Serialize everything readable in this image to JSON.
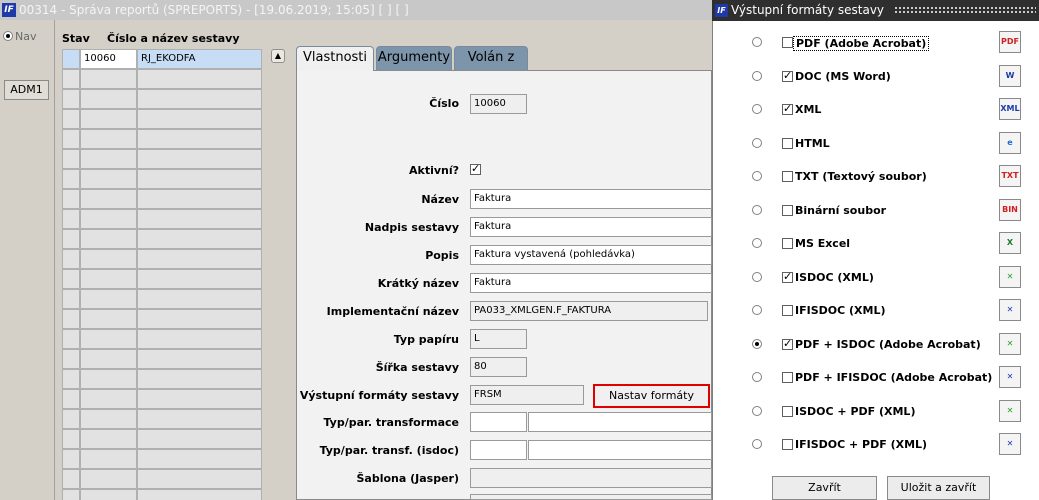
{
  "main_window": {
    "title": "00314 - Správa reportů (SPREPORTS) - [19.06.2019; 15:05]  [ ]  [ ]",
    "nav_label": "Nav",
    "adm_label": "ADM1",
    "grid": {
      "col_stav": "Stav",
      "col_cislo": "Číslo a název sestavy",
      "selected_row": {
        "cislo": "10060",
        "nazev": "RJ_EKODFA"
      },
      "empty_rows": 22
    },
    "tabs": [
      {
        "label": "Vlastnosti",
        "active": true
      },
      {
        "label": "Argumenty",
        "active": false
      },
      {
        "label": "Volán z",
        "active": false
      }
    ],
    "form": {
      "cislo": {
        "label": "Číslo",
        "value": "10060"
      },
      "aktivni": {
        "label": "Aktivní?",
        "checked": true
      },
      "nazev": {
        "label": "Název",
        "value": "Faktura"
      },
      "nadpis": {
        "label": "Nadpis sestavy",
        "value": "Faktura"
      },
      "popis": {
        "label": "Popis",
        "value": "Faktura vystavená (pohledávka)"
      },
      "kratky": {
        "label": "Krátký název",
        "value": "Faktura"
      },
      "implementacni": {
        "label": "Implementační název",
        "value": "PA033_XMLGEN.F_FAKTURA"
      },
      "typ_papiru": {
        "label": "Typ papíru",
        "value": "L"
      },
      "sirka": {
        "label": "Šířka sestavy",
        "value": "80"
      },
      "vystupni": {
        "label": "Výstupní formáty sestavy",
        "value": "FRSM",
        "button": "Nastav formáty"
      },
      "transformace": {
        "label": "Typ/par. transformace",
        "value": ""
      },
      "transf_isdoc": {
        "label": "Typ/par. transf. (isdoc)",
        "value": ""
      },
      "sablona": {
        "label": "Šablona (Jasper)",
        "value": ""
      }
    }
  },
  "dialog": {
    "title": "Výstupní formáty sestavy",
    "formats": [
      {
        "label": "PDF (Adobe Acrobat)",
        "checked": false,
        "default": false,
        "icon": "pdf-icon",
        "icon_text": "PDF",
        "icon_color": "#d02020"
      },
      {
        "label": "DOC (MS Word)",
        "checked": true,
        "default": false,
        "icon": "word-icon",
        "icon_text": "W",
        "icon_color": "#1f3aa8"
      },
      {
        "label": "XML",
        "checked": true,
        "default": false,
        "icon": "xml-icon",
        "icon_text": "XML",
        "icon_color": "#1f3aa8"
      },
      {
        "label": "HTML",
        "checked": false,
        "default": false,
        "icon": "html-icon",
        "icon_text": "e",
        "icon_color": "#1e6fd0"
      },
      {
        "label": "TXT (Textový soubor)",
        "checked": false,
        "default": false,
        "icon": "txt-icon",
        "icon_text": "TXT",
        "icon_color": "#d02020"
      },
      {
        "label": "Binární soubor",
        "checked": false,
        "default": false,
        "icon": "binary-icon",
        "icon_text": "BIN",
        "icon_color": "#d02020"
      },
      {
        "label": "MS Excel",
        "checked": false,
        "default": false,
        "icon": "excel-icon",
        "icon_text": "X",
        "icon_color": "#1e7a2e"
      },
      {
        "label": "ISDOC (XML)",
        "checked": true,
        "default": false,
        "icon": "isdoc-icon",
        "icon_text": "✕",
        "icon_color": "#2a9a2a"
      },
      {
        "label": "IFISDOC (XML)",
        "checked": false,
        "default": false,
        "icon": "ifisdoc-icon",
        "icon_text": "✕",
        "icon_color": "#1f3aa8"
      },
      {
        "label": "PDF + ISDOC (Adobe Acrobat)",
        "checked": true,
        "default": true,
        "icon": "pdf-isdoc-icon",
        "icon_text": "✕",
        "icon_color": "#2a9a2a"
      },
      {
        "label": "PDF + IFISDOC (Adobe Acrobat)",
        "checked": false,
        "default": false,
        "icon": "pdf-ifisdoc-icon",
        "icon_text": "✕",
        "icon_color": "#1f3aa8"
      },
      {
        "label": "ISDOC + PDF (XML)",
        "checked": false,
        "default": false,
        "icon": "isdoc-pdf-icon",
        "icon_text": "✕",
        "icon_color": "#2a9a2a"
      },
      {
        "label": "IFISDOC + PDF (XML)",
        "checked": false,
        "default": false,
        "icon": "ifisdoc-pdf-icon",
        "icon_text": "✕",
        "icon_color": "#1f3aa8"
      }
    ],
    "btn_close": "Zavřít",
    "btn_save": "Uložit a zavřít"
  }
}
